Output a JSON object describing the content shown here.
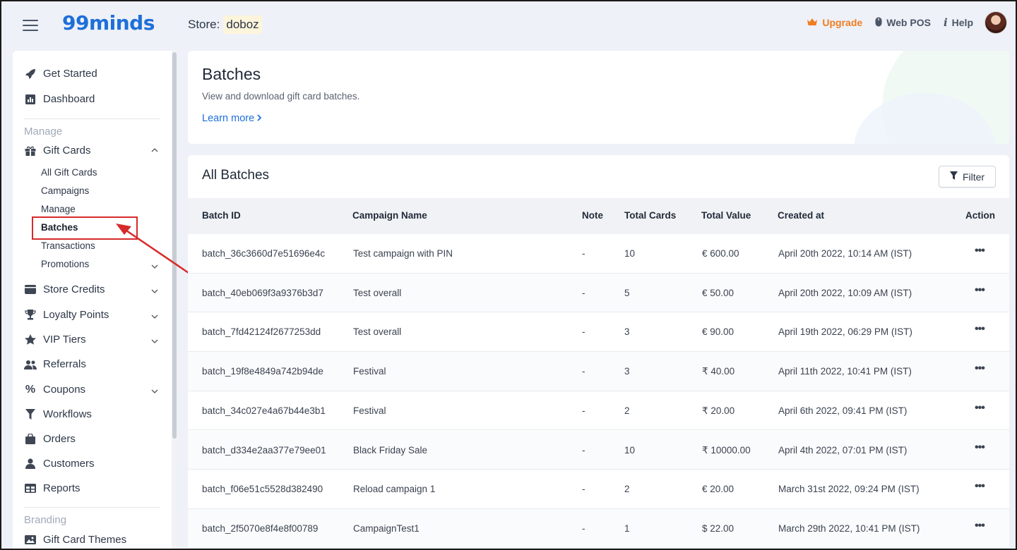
{
  "app": {
    "name": "99minds",
    "store_label": "Store:",
    "store_name": "doboz"
  },
  "topbar": {
    "upgrade_label": "Upgrade",
    "webpos_label": "Web POS",
    "help_label": "Help"
  },
  "sidebar": {
    "get_started": "Get Started",
    "dashboard": "Dashboard",
    "section_manage": "Manage",
    "gift_cards": "Gift Cards",
    "gift_sub": [
      "All Gift Cards",
      "Campaigns",
      "Manage",
      "Batches",
      "Transactions",
      "Promotions"
    ],
    "store_credits": "Store Credits",
    "loyalty_points": "Loyalty Points",
    "vip_tiers": "VIP Tiers",
    "referrals": "Referrals",
    "coupons": "Coupons",
    "workflows": "Workflows",
    "orders": "Orders",
    "customers": "Customers",
    "reports": "Reports",
    "section_branding": "Branding",
    "gift_card_themes": "Gift Card Themes"
  },
  "header": {
    "title": "Batches",
    "subtitle": "View and download gift card batches.",
    "learn_more": "Learn more"
  },
  "batches": {
    "title": "All Batches",
    "filter_label": "Filter",
    "columns": [
      "Batch ID",
      "Campaign Name",
      "Note",
      "Total Cards",
      "Total Value",
      "Created at",
      "Action"
    ],
    "rows": [
      {
        "id": "batch_36c3660d7e51696e4c",
        "campaign": "Test campaign with PIN",
        "note": "-",
        "cards": "10",
        "value": "€ 600.00",
        "created": "April 20th 2022, 10:14 AM (IST)",
        "action": "•••"
      },
      {
        "id": "batch_40eb069f3a9376b3d7",
        "campaign": "Test overall",
        "note": "-",
        "cards": "5",
        "value": "€ 50.00",
        "created": "April 20th 2022, 10:09 AM (IST)",
        "action": "•••"
      },
      {
        "id": "batch_7fd42124f2677253dd",
        "campaign": "Test overall",
        "note": "-",
        "cards": "3",
        "value": "€ 90.00",
        "created": "April 19th 2022, 06:29 PM (IST)",
        "action": "•••"
      },
      {
        "id": "batch_19f8e4849a742b94de",
        "campaign": "Festival",
        "note": "-",
        "cards": "3",
        "value": "₹ 40.00",
        "created": "April 11th 2022, 10:41 PM (IST)",
        "action": "•••"
      },
      {
        "id": "batch_34c027e4a67b44e3b1",
        "campaign": "Festival",
        "note": "-",
        "cards": "2",
        "value": "₹ 20.00",
        "created": "April 6th 2022, 09:41 PM (IST)",
        "action": "•••"
      },
      {
        "id": "batch_d334e2aa377e79ee01",
        "campaign": "Black Friday Sale",
        "note": "-",
        "cards": "10",
        "value": "₹ 10000.00",
        "created": "April 4th 2022, 07:01 PM (IST)",
        "action": "•••"
      },
      {
        "id": "batch_f06e51c5528d382490",
        "campaign": "Reload campaign 1",
        "note": "-",
        "cards": "2",
        "value": "€ 20.00",
        "created": "March 31st 2022, 09:24 PM (IST)",
        "action": "•••"
      },
      {
        "id": "batch_2f5070e8f4e8f00789",
        "campaign": "CampaignTest1",
        "note": "-",
        "cards": "1",
        "value": "$ 22.00",
        "created": "March 29th 2022, 10:41 PM (IST)",
        "action": "•••"
      }
    ]
  },
  "colors": {
    "brand": "#1e6fd9",
    "accent_upgrade": "#ef7d22",
    "highlight": "#d62a2a"
  }
}
